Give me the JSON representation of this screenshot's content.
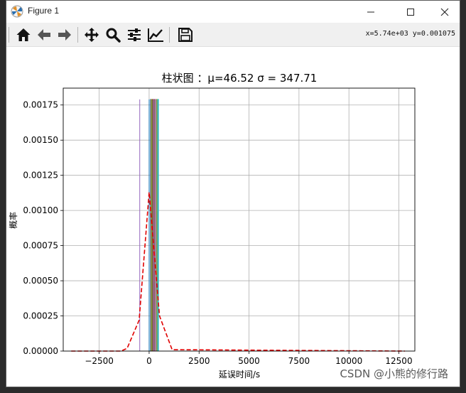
{
  "window": {
    "title": "Figure 1",
    "coordinate_readout": "x=5.74e+03 y=0.001075"
  },
  "toolbar": {
    "buttons": [
      {
        "name": "home-icon"
      },
      {
        "name": "back-icon"
      },
      {
        "name": "forward-icon"
      },
      {
        "name": "pan-icon"
      },
      {
        "name": "zoom-icon"
      },
      {
        "name": "configure-subplots-icon"
      },
      {
        "name": "edit-axis-icon"
      },
      {
        "name": "save-icon"
      }
    ]
  },
  "watermark": "CSDN @小熊的修行路",
  "colors": {
    "bar_fill": "#5f8f8f",
    "dashed_line": "#e00000",
    "grid": "#b0b0b0"
  },
  "chart_data": {
    "type": "bar",
    "title": "柱状图 ：μ=46.52 σ = 347.71",
    "xlabel": "延误时间/s",
    "ylabel": "概率",
    "xlim": [
      -4300,
      13300
    ],
    "ylim": [
      0,
      0.00187
    ],
    "xticks": [
      -2500,
      0,
      2500,
      5000,
      7500,
      10000,
      12500
    ],
    "xtick_labels": [
      "−2500",
      "0",
      "2500",
      "5000",
      "7500",
      "10000",
      "12500"
    ],
    "yticks": [
      0,
      0.00025,
      0.0005,
      0.00075,
      0.001,
      0.00125,
      0.0015,
      0.00175
    ],
    "ytick_labels": [
      "0.00000",
      "0.00025",
      "0.00050",
      "0.00075",
      "0.00100",
      "0.00125",
      "0.00150",
      "0.00175"
    ],
    "grid": true,
    "histogram": {
      "x_start": 60,
      "x_end": 470,
      "value": 0.00179,
      "stroke_colors": [
        "#1f77b4",
        "#ff7f0e",
        "#2ca02c",
        "#d62728",
        "#9467bd",
        "#8c564b",
        "#e377c2",
        "#7f7f7f",
        "#bcbd22",
        "#17becf"
      ]
    },
    "outlier_lines": [
      {
        "x": -470,
        "y": 0.00179,
        "color": "#9467bd"
      },
      {
        "x": 0,
        "y": 0.00179,
        "color": "#1f77b4"
      }
    ],
    "pdf_curve": {
      "style": "dashed",
      "x": [
        -3900,
        -1400,
        -1100,
        -500,
        0,
        520,
        1150,
        12800
      ],
      "y": [
        0,
        0,
        2e-05,
        0.00022,
        0.00113,
        0.00025,
        1e-05,
        0
      ]
    }
  }
}
